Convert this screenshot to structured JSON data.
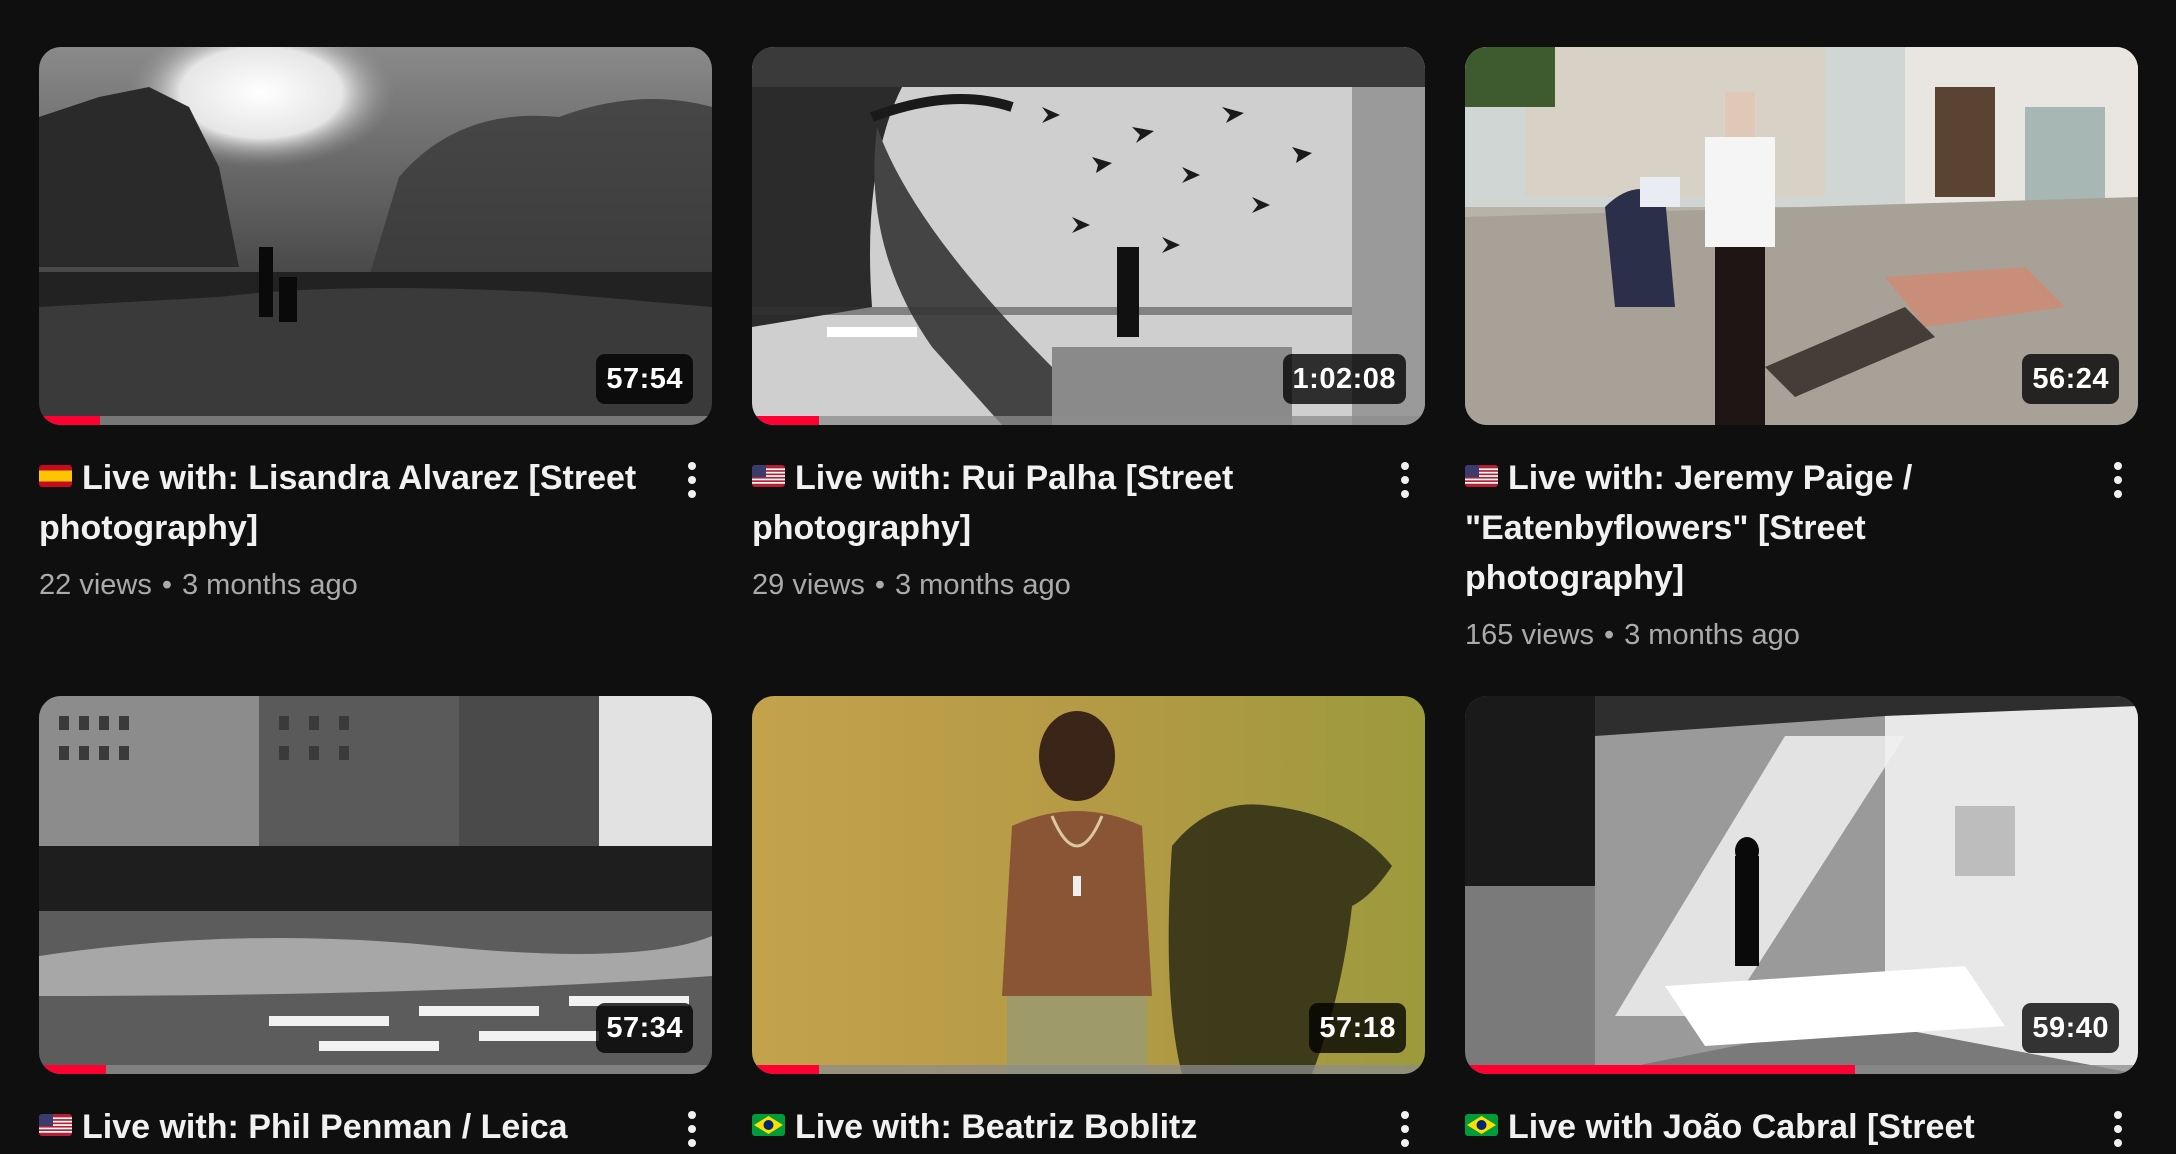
{
  "videos": [
    {
      "title": "Live with: Lisandra Alvarez [Street photography]",
      "flag": "spain-flag",
      "views": "22 views",
      "age": "3 months ago",
      "duration": "57:54",
      "watched_fraction": 0.09
    },
    {
      "title": "Live with: Rui Palha [Street photography]",
      "flag": "usa-flag",
      "views": "29 views",
      "age": "3 months ago",
      "duration": "1:02:08",
      "watched_fraction": 0.1
    },
    {
      "title": "Live with: Jeremy Paige / \"Eatenbyflowers\" [Street photography]",
      "flag": "usa-flag",
      "views": "165 views",
      "age": "3 months ago",
      "duration": "56:24",
      "watched_fraction": 0
    },
    {
      "title": "Live with: Phil Penman / Leica",
      "flag": "usa-flag",
      "views": "",
      "age": "",
      "duration": "57:34",
      "watched_fraction": 0.1
    },
    {
      "title": "Live with: Beatriz Boblitz",
      "flag": "brazil-flag",
      "views": "",
      "age": "",
      "duration": "57:18",
      "watched_fraction": 0.1
    },
    {
      "title": "Live with João Cabral [Street",
      "flag": "brazil-flag",
      "views": "",
      "age": "",
      "duration": "59:40",
      "watched_fraction": 0.58
    }
  ],
  "separator": "•",
  "colors": {
    "background": "#0f0f0f",
    "progress": "#ff0033",
    "title": "#f1f1f1",
    "stats": "#aaaaaa"
  }
}
